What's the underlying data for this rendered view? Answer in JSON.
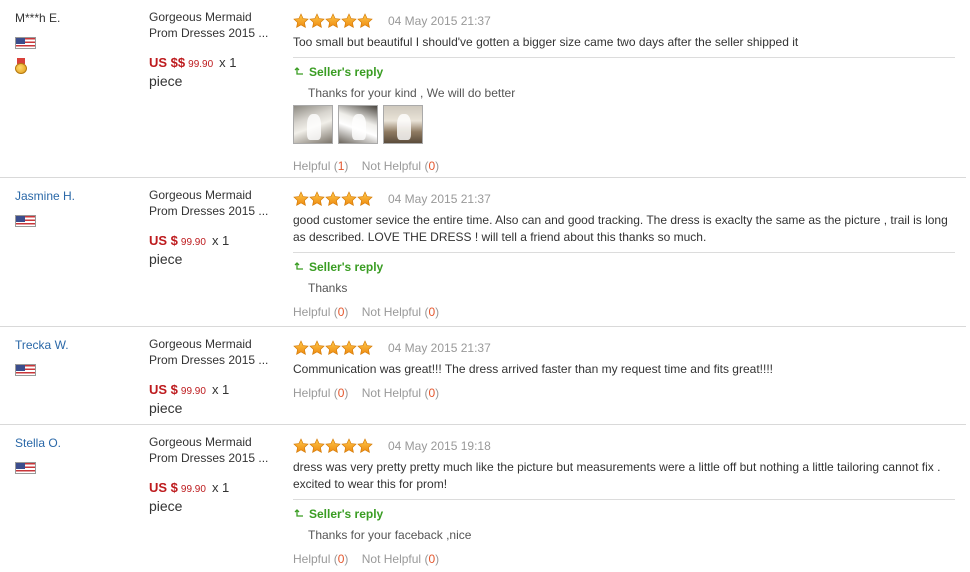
{
  "icons": {
    "star": "star-icon",
    "flag": "us-flag-icon",
    "medal": "medal-icon",
    "reply": "reply-arrow-icon"
  },
  "colors": {
    "star": "#f39c12",
    "price": "#bd1a1d",
    "reply": "#3a9d23",
    "count": "#e4572e",
    "link": "#2a68a8"
  },
  "reviews": [
    {
      "user": "M***h E.",
      "product": "Gorgeous Mermaid Prom Dresses 2015 ...",
      "product_line1": "Gorgeous Mermaid",
      "product_line2": "Prom Dresses 2015 ...",
      "price_currency": "US $$",
      "price_value": "99.90",
      "quantity": "x 1",
      "unit": "piece",
      "rating": 5,
      "date": "04 May 2015 21:37",
      "text": "Too small but beautiful I should've gotten a bigger size came two days after the seller shipped it",
      "reply_label": "Seller's reply",
      "reply": "Thanks for your kind , We will do better",
      "helpful_label": "Helpful",
      "helpful_count": "1",
      "not_helpful_label": "Not Helpful",
      "not_helpful_count": "0"
    },
    {
      "user": "Jasmine H.",
      "product_line1": "Gorgeous Mermaid",
      "product_line2": "Prom Dresses 2015 ...",
      "price_currency": "US $",
      "price_value": "99.90",
      "quantity": "x 1",
      "unit": "piece",
      "rating": 5,
      "date": "04 May 2015 21:37",
      "text": "good customer sevice the entire time. Also can and good tracking. The dress is exaclty the same as the picture , trail is long as described. LOVE THE DRESS ! will tell a friend about this thanks so much.",
      "reply_label": "Seller's reply",
      "reply": "Thanks",
      "helpful_label": "Helpful",
      "helpful_count": "0",
      "not_helpful_label": "Not Helpful",
      "not_helpful_count": "0"
    },
    {
      "user": "Trecka W.",
      "product_line1": "Gorgeous Mermaid",
      "product_line2": "Prom Dresses 2015 ...",
      "price_currency": "US $",
      "price_value": "99.90",
      "quantity": "x 1",
      "unit": "piece",
      "rating": 5,
      "date": "04 May 2015 21:37",
      "text": "Communication was great!!! The dress arrived faster than my request time and fits great!!!!",
      "helpful_label": "Helpful",
      "helpful_count": "0",
      "not_helpful_label": "Not Helpful",
      "not_helpful_count": "0"
    },
    {
      "user": "Stella O.",
      "product_line1": "Gorgeous Mermaid",
      "product_line2": "Prom Dresses 2015 ...",
      "price_currency": "US $",
      "price_value": "99.90",
      "quantity": "x 1",
      "unit": "piece",
      "rating": 5,
      "date": "04 May 2015 19:18",
      "text": "dress was very pretty pretty much like the picture but measurements were a little off but nothing a little tailoring cannot fix . excited to wear this for prom!",
      "reply_label": "Seller's reply",
      "reply": "Thanks for your faceback ,nice",
      "helpful_label": "Helpful",
      "helpful_count": "0",
      "not_helpful_label": "Not Helpful",
      "not_helpful_count": "0"
    }
  ]
}
